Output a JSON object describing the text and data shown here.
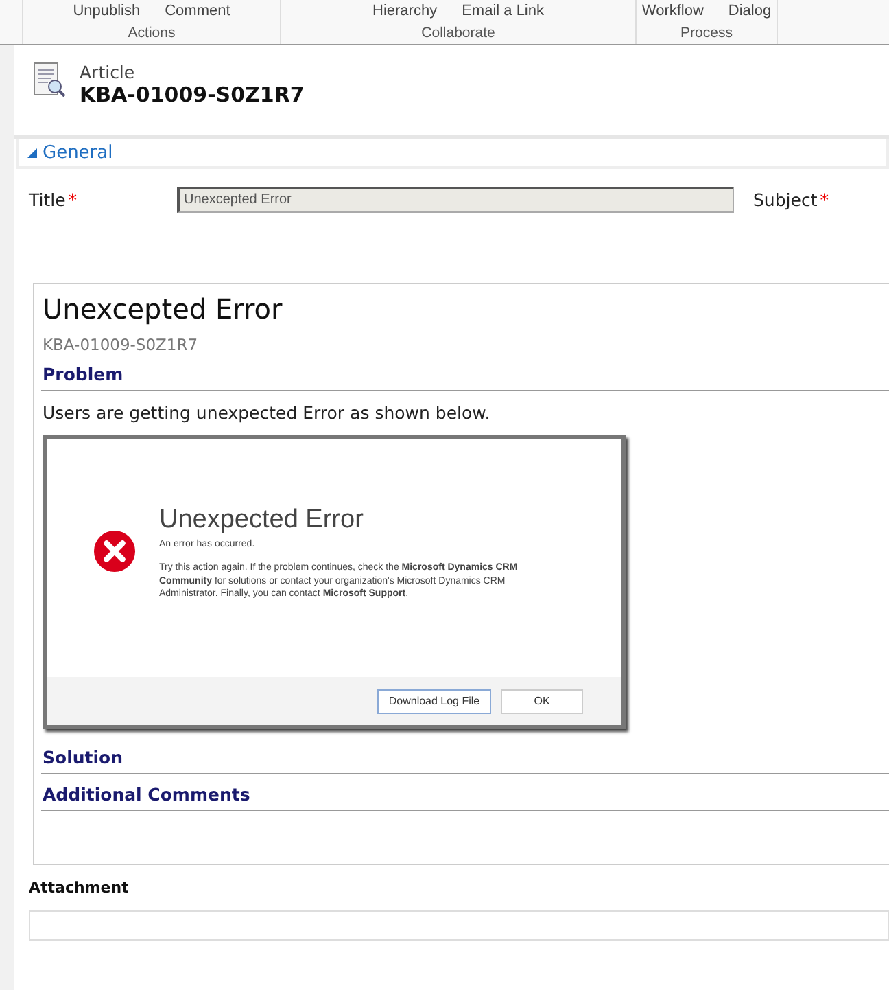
{
  "ribbon": {
    "groups": [
      {
        "label": "Actions",
        "items": [
          "Unpublish",
          "Comment"
        ]
      },
      {
        "label": "Collaborate",
        "items": [
          "Hierarchy",
          "Email a Link"
        ]
      },
      {
        "label": "Process",
        "items": [
          "Workflow",
          "Dialog"
        ]
      }
    ]
  },
  "header": {
    "entity": "Article",
    "record": "KBA-01009-S0Z1R7"
  },
  "section": {
    "title": "General",
    "expanded": true
  },
  "fields": [
    {
      "label": "Title",
      "required_mark": "*",
      "value": "Unexcepted Error"
    },
    {
      "label": "Subject",
      "required_mark": "*"
    }
  ],
  "article": {
    "title": "Unexcepted Error",
    "number": "KBA-01009-S0Z1R7",
    "sections": [
      {
        "heading": "Problem",
        "text": "Users are getting unexpected Error as shown below.",
        "dialog": {
          "title": "Unexpected Error",
          "message": "An error has occurred.",
          "details": "Try this action again. If the problem continues, check the **Microsoft Dynamics CRM Community** for solutions or contact your organization's Microsoft Dynamics CRM Administrator. Finally, you can contact **Microsoft Support**.",
          "buttons": [
            "Download Log File",
            "OK"
          ]
        }
      },
      {
        "heading": "Solution"
      },
      {
        "heading": "Additional Comments"
      }
    ]
  },
  "attachment": {
    "label": "Attachment"
  }
}
